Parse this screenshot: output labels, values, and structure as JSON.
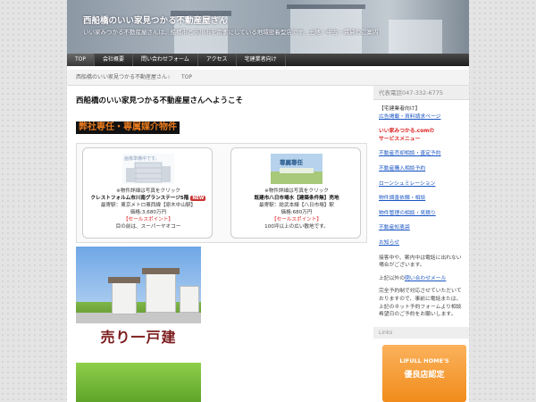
{
  "header": {
    "title": "西船橋のいい家見つかる不動産屋さん",
    "description": "いい家みつかる不動産屋さんは、船橋市と市川市を南側にしている地域密着型店です。土地・中古・賃貸のご案内"
  },
  "nav": {
    "items": [
      {
        "label": "TOP"
      },
      {
        "label": "会社概要"
      },
      {
        "label": "問い合わせフォーム"
      },
      {
        "label": "アクセス"
      },
      {
        "label": "宅建業者向け"
      }
    ]
  },
  "breadcrumb": {
    "home": "西船橋のいい家見つかる不動産屋さん",
    "current": "TOP"
  },
  "main": {
    "page_title": "西船橋のいい家見つかる不動産屋さんへようこそ",
    "section_title": "弊社専任・専属媒介物件",
    "cards": [
      {
        "photo_caption": "画像準備中です。",
        "note": "※物件詳細は写真をクリック",
        "name": "クレストフォルム市川南グランステージ5階",
        "badge": "NEW",
        "station": "最寄駅：東京メトロ東西線【原木中山駅】",
        "price": "価格:3,680万円",
        "point_label": "【セールスポイント】",
        "point_text": "目の前は、スーパーヤオコー"
      },
      {
        "photo_caption": "専属専任",
        "note": "※物件詳細は写真をクリック",
        "name": "既建市八日市場水【建築条件無】売地",
        "badge": "",
        "station": "最寄駅：総武本線【八日市場】駅",
        "price": "価格:680万円",
        "point_label": "【セールスポイント】",
        "point_text": "100坪以上の広い敷地です。"
      }
    ],
    "banner_label": "売り一戸建"
  },
  "sidebar": {
    "head": "代表電話047-332-6775",
    "links": [
      {
        "label": "【宅建業者向け】",
        "type": "plain"
      },
      {
        "label": "広告掲載・資料請求ページ",
        "type": "link"
      },
      {
        "label": "いい家みつかる.comの",
        "type": "red"
      },
      {
        "label": "サービスメニュー",
        "type": "red"
      },
      {
        "label": "不動産売却相談・査定予約",
        "type": "link"
      },
      {
        "label": "不動産購入相談予約",
        "type": "link"
      },
      {
        "label": "ローンシュミレーション",
        "type": "link"
      },
      {
        "label": "物件調査依頼・相談",
        "type": "link"
      },
      {
        "label": "物件管理の相談・見積り",
        "type": "link"
      },
      {
        "label": "不動産知恵袋",
        "type": "link"
      },
      {
        "label": "お知らせ",
        "type": "link"
      }
    ],
    "note1": "接客中や、案内中は電話に出れない場合がございます。",
    "note2_pre": "上記以外の",
    "note2_link": "問い合わせメール",
    "note3": "完全予約制で対応させていただいておりますので、事前に電話または、上記のネット予約フォームより相談希望日のご予約をお願いします。",
    "links_head": "Links",
    "homes_brand": "LIFULL HOME'S",
    "homes_cert": "優良店認定"
  }
}
